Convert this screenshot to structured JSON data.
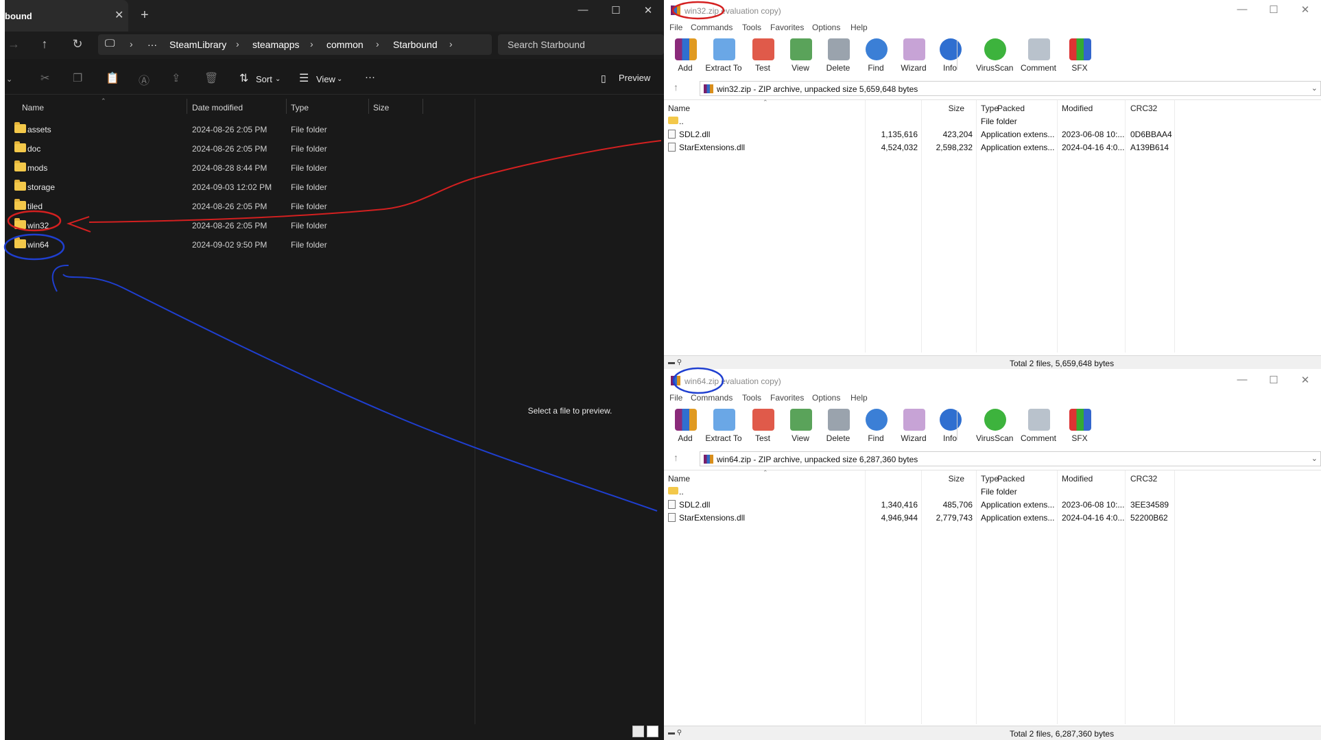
{
  "explorer": {
    "tab_title": "bound",
    "tab_close": "✕",
    "new_tab": "+",
    "minimize": "—",
    "maximize": "☐",
    "close": "✕",
    "breadcrumb": {
      "computer_icon": "🖵",
      "more": "···",
      "items": [
        "SteamLibrary",
        "steamapps",
        "common",
        "Starbound"
      ],
      "sep": "›"
    },
    "search_placeholder": "Search Starbound",
    "toolbar": {
      "sort_label": "Sort",
      "view_label": "View",
      "more_label": "···",
      "preview_label": "Preview"
    },
    "columns": [
      "Name",
      "Date modified",
      "Type",
      "Size"
    ],
    "rows": [
      {
        "name": "assets",
        "date": "2024-08-26 2:05 PM",
        "type": "File folder"
      },
      {
        "name": "doc",
        "date": "2024-08-26 2:05 PM",
        "type": "File folder"
      },
      {
        "name": "mods",
        "date": "2024-08-28 8:44 PM",
        "type": "File folder"
      },
      {
        "name": "storage",
        "date": "2024-09-03 12:02 PM",
        "type": "File folder"
      },
      {
        "name": "tiled",
        "date": "2024-08-26 2:05 PM",
        "type": "File folder"
      },
      {
        "name": "win32",
        "date": "2024-08-26 2:05 PM",
        "type": "File folder"
      },
      {
        "name": "win64",
        "date": "2024-09-02 9:50 PM",
        "type": "File folder"
      }
    ],
    "preview_message": "Select a file to preview."
  },
  "rar_common": {
    "menu": [
      "File",
      "Commands",
      "Tools",
      "Favorites",
      "Options",
      "Help"
    ],
    "tools": [
      "Add",
      "Extract To",
      "Test",
      "View",
      "Delete",
      "Find",
      "Wizard",
      "Info",
      "VirusScan",
      "Comment",
      "SFX"
    ],
    "columns": [
      "Name",
      "Size",
      "Packed",
      "Type",
      "Modified",
      "CRC32"
    ],
    "up_arrow": "↑",
    "dropdown": "⌄",
    "minimize": "—",
    "maximize": "☐",
    "close": "✕"
  },
  "rar1": {
    "title_name": "win32.zip",
    "title_suffix": "evaluation copy)",
    "path_text": "win32.zip - ZIP archive, unpacked size 5,659,648 bytes",
    "rows": [
      {
        "name": "..",
        "size": "",
        "packed": "",
        "type": "File folder",
        "modified": "",
        "crc": ""
      },
      {
        "name": "SDL2.dll",
        "size": "1,135,616",
        "packed": "423,204",
        "type": "Application extens...",
        "modified": "2023-06-08 10:...",
        "crc": "0D6BBAA4"
      },
      {
        "name": "StarExtensions.dll",
        "size": "4,524,032",
        "packed": "2,598,232",
        "type": "Application extens...",
        "modified": "2024-04-16 4:0...",
        "crc": "A139B614"
      }
    ],
    "status": "Total 2 files, 5,659,648 bytes"
  },
  "rar2": {
    "title_name": "win64.zip",
    "title_suffix": "evaluation copy)",
    "path_text": "win64.zip - ZIP archive, unpacked size 6,287,360 bytes",
    "rows": [
      {
        "name": "..",
        "size": "",
        "packed": "",
        "type": "File folder",
        "modified": "",
        "crc": ""
      },
      {
        "name": "SDL2.dll",
        "size": "1,340,416",
        "packed": "485,706",
        "type": "Application extens...",
        "modified": "2023-06-08 10:...",
        "crc": "3EE34589"
      },
      {
        "name": "StarExtensions.dll",
        "size": "4,946,944",
        "packed": "2,779,743",
        "type": "Application extens...",
        "modified": "2024-04-16 4:0...",
        "crc": "52200B62"
      }
    ],
    "status": "Total 2 files, 6,287,360 bytes"
  },
  "colors": {
    "annotation_red": "#d42020",
    "annotation_blue": "#1f3fd0"
  }
}
